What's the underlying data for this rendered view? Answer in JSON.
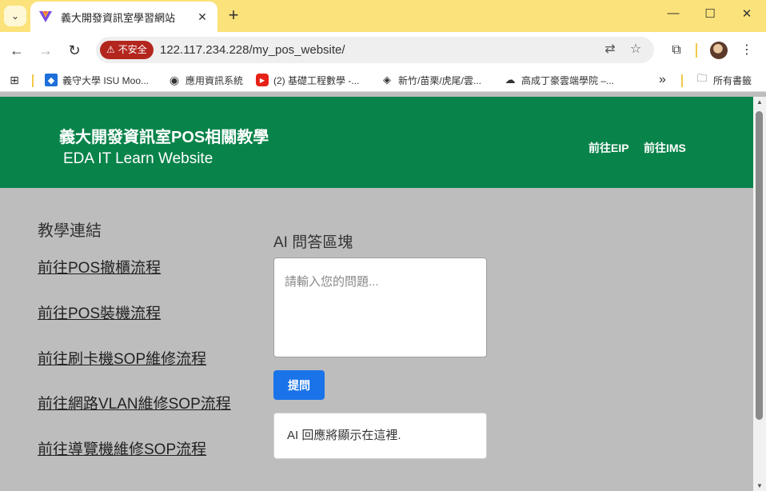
{
  "browser": {
    "tab": {
      "title": "義大開發資訊室學習網站"
    },
    "omnibox": {
      "security_label": "不安全",
      "url": "122.117.234.228/my_pos_website/"
    },
    "bookmarks": [
      {
        "label": "義守大學 ISU Moo..."
      },
      {
        "label": "應用資訊系統"
      },
      {
        "label": "(2) 基礎工程數學 -..."
      },
      {
        "label": "新竹/苗栗/虎尾/雲..."
      },
      {
        "label": "高成丁豪雲端學院 –..."
      }
    ],
    "bookmarks_folder": "所有書籤",
    "overflow_label": "»"
  },
  "header": {
    "title": "義大開發資訊室POS相關教學",
    "subtitle": "EDA IT Learn Website",
    "links": [
      {
        "label": "前往EIP"
      },
      {
        "label": "前往IMS"
      }
    ]
  },
  "sidebar": {
    "heading": "教學連結",
    "links": [
      {
        "label": "前往POS撤櫃流程"
      },
      {
        "label": "前往POS裝機流程"
      },
      {
        "label": "前往刷卡機SOP維修流程"
      },
      {
        "label": "前往網路VLAN維修SOP流程"
      },
      {
        "label": "前往導覽機維修SOP流程"
      }
    ]
  },
  "ai": {
    "heading": "AI 問答區塊",
    "placeholder": "請輸入您的問題...",
    "value": "",
    "button_label": "提問",
    "response": "AI 回應將顯示在這裡."
  },
  "colors": {
    "header_green": "#08834a",
    "tabstrip_yellow": "#fbe27a",
    "page_background": "#bdbdbd",
    "button_blue": "#1a73e8",
    "insecure_red": "#b3261e"
  }
}
